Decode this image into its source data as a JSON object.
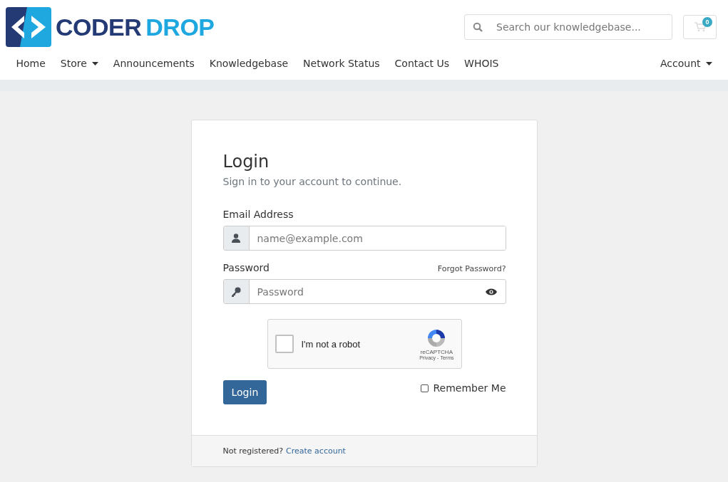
{
  "logo": {
    "part_1": "CODER",
    "part_2": "DROP"
  },
  "search": {
    "placeholder": "Search our knowledgebase..."
  },
  "cart": {
    "count": "0"
  },
  "nav": [
    {
      "label": "Home",
      "dropdown": false
    },
    {
      "label": "Store",
      "dropdown": true
    },
    {
      "label": "Announcements",
      "dropdown": false
    },
    {
      "label": "Knowledgebase",
      "dropdown": false
    },
    {
      "label": "Network Status",
      "dropdown": false
    },
    {
      "label": "Contact Us",
      "dropdown": false
    },
    {
      "label": "WHOIS",
      "dropdown": false
    }
  ],
  "account_menu": {
    "label": "Account",
    "dropdown": true
  },
  "login": {
    "title": "Login",
    "subtitle": "Sign in to your account to continue.",
    "email_label": "Email Address",
    "email_placeholder": "name@example.com",
    "password_label": "Password",
    "forgot": "Forgot Password?",
    "password_placeholder": "Password",
    "captcha": {
      "label": "I'm not a robot",
      "checked": false,
      "brand": "reCAPTCHA",
      "privacy": "Privacy",
      "separator": "-",
      "terms": "Terms"
    },
    "submit": "Login",
    "remember": {
      "label": "Remember Me",
      "checked": false
    },
    "footer_text": "Not registered?",
    "footer_link": "Create account"
  }
}
